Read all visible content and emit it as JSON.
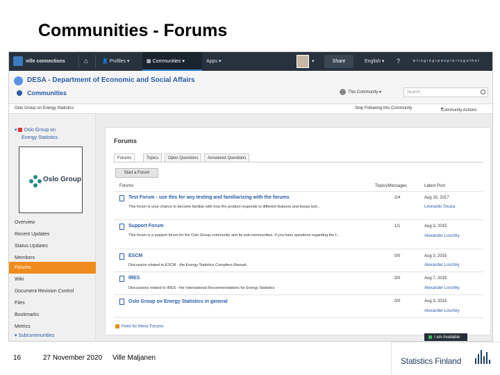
{
  "slide": {
    "title": "Communities - Forums",
    "page_number": "16",
    "date": "27 November 2020",
    "author": "Ville Maljanen",
    "logo_text": "Statistics Finland"
  },
  "topnav": {
    "brand": "ville connections",
    "profiles": "Profiles",
    "communities": "Communities",
    "apps": "Apps",
    "share": "Share",
    "language": "English",
    "tagline": "b r i n g i n g • p e o p l e • t o g e t h e r"
  },
  "header": {
    "org": "DESA - Department of Economic and Social Affairs",
    "section": "Communities",
    "scope": "This Community",
    "search_placeholder": "Search"
  },
  "subhead": {
    "community": "Oslo Group on Energy Statistics",
    "stop_following": "Stop Following this Community",
    "community_actions": "Community Actions"
  },
  "sidebar": {
    "group_line1": "Oslo Group on",
    "group_line2": "Energy Statistics",
    "logo_name": "Oslo Group",
    "items": [
      {
        "label": "Overview"
      },
      {
        "label": "Recent Updates"
      },
      {
        "label": "Status Updates"
      },
      {
        "label": "Members"
      },
      {
        "label": "Forums"
      },
      {
        "label": "Wiki"
      },
      {
        "label": "Document Revision Control"
      },
      {
        "label": "Files"
      },
      {
        "label": "Bookmarks"
      },
      {
        "label": "Metrics"
      },
      {
        "label": "Subcommunities"
      }
    ]
  },
  "forums": {
    "title": "Forums",
    "tabs": [
      "Forums",
      "Topics",
      "Open Questions",
      "Answered Questions"
    ],
    "start_button": "Start a Forum",
    "columns": {
      "forum": "Forums",
      "topics": "Topics/Messages",
      "last": "Latest Post"
    },
    "rows": [
      {
        "title": "Test Forum - use this for any testing and familiarizing with the forums",
        "desc": "This forum is your chance to become familiar with how the product responds to different features and keeps test...",
        "count": "2/4",
        "date": "Aug 10, 2017",
        "user": "Leonardo Souza"
      },
      {
        "title": "Support Forum",
        "desc": "This forum is a support forum for the Oslo Group community and its sub-communities. If you have questions regarding the f...",
        "count": "1/1",
        "date": "Aug 3, 2015",
        "user": "Alexander Loschky"
      },
      {
        "title": "ESCM",
        "desc": "Discussion related to ESCM - the Energy Statistics Compilers Manual",
        "count": "0/0",
        "date": "Aug 3, 2015",
        "user": "Alexander Loschky"
      },
      {
        "title": "IRES",
        "desc": "Discussions related to IRES - the International Recommendations for Energy Statistics",
        "count": "0/0",
        "date": "Aug 7, 2015",
        "user": "Alexander Loschky"
      },
      {
        "title": "Oslo Group on Energy Statistics in general",
        "desc": "",
        "count": "0/0",
        "date": "Aug 3, 2015",
        "user": "Alexander Loschky"
      }
    ],
    "feed_link": "Feed for these Forums"
  },
  "status": {
    "available": "I am Available"
  }
}
